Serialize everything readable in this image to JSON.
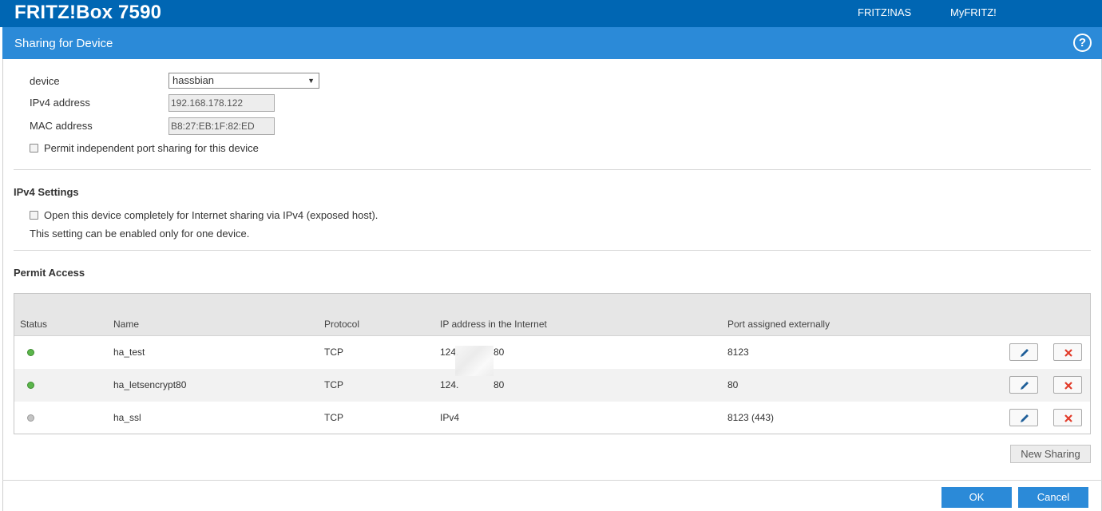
{
  "header": {
    "brand": "FRITZ!Box 7590",
    "nav": [
      "FRITZ!NAS",
      "MyFRITZ!"
    ]
  },
  "titlebar": {
    "title": "Sharing for Device",
    "help_symbol": "?"
  },
  "device_section": {
    "device_label": "device",
    "device_value": "hassbian",
    "ipv4_label": "IPv4 address",
    "ipv4_value": "192.168.178.122",
    "mac_label": "MAC address",
    "mac_value": "B8:27:EB:1F:82:ED",
    "permit_independent_label": "Permit independent port sharing for this device",
    "permit_independent_checked": false
  },
  "ipv4_settings": {
    "title": "IPv4 Settings",
    "exposed_host_label": "Open this device completely for Internet sharing via IPv4 (exposed host).",
    "exposed_host_checked": false,
    "note": "This setting can be enabled only for one device."
  },
  "permit_access": {
    "title": "Permit Access",
    "columns": [
      "Status",
      "Name",
      "Protocol",
      "IP address in the Internet",
      "Port assigned externally"
    ],
    "rows": [
      {
        "status": "active",
        "name": "ha_test",
        "protocol": "TCP",
        "ip_prefix": "124.",
        "ip_suffix": "80",
        "port": "8123"
      },
      {
        "status": "active",
        "name": "ha_letsencrypt80",
        "protocol": "TCP",
        "ip_prefix": "124.",
        "ip_suffix": "80",
        "port": "80"
      },
      {
        "status": "inactive",
        "name": "ha_ssl",
        "protocol": "TCP",
        "ip_prefix": "IPv4",
        "ip_suffix": "",
        "port": "8123 (443)"
      }
    ],
    "row_icons": [
      "pencil-icon",
      "close-icon"
    ]
  },
  "buttons": {
    "new_sharing": "New Sharing",
    "ok": "OK",
    "cancel": "Cancel"
  },
  "colors": {
    "header_bg": "#0066b3",
    "titlebar_bg": "#2b8ad8",
    "status_active": "#5bb64b",
    "status_inactive": "#c4c4c4",
    "delete_red": "#e23b2a",
    "edit_blue": "#1f5f99"
  }
}
